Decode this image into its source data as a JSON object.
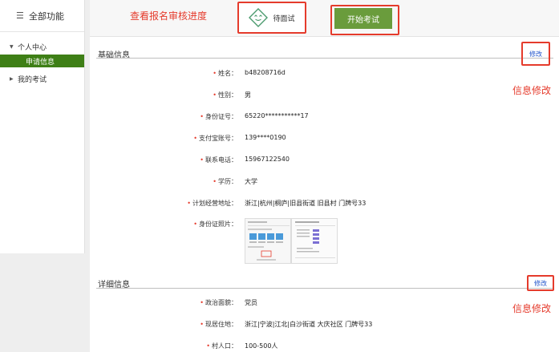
{
  "sidebar": {
    "header": "全部功能",
    "groups": [
      {
        "label": "个人中心",
        "children": [
          {
            "label": "申请信息",
            "active": true
          }
        ]
      },
      {
        "label": "我的考试",
        "children": []
      }
    ]
  },
  "annotations": {
    "status_hint": "查看报名审核进度",
    "edit_hint_1": "信息修改",
    "edit_hint_2": "信息修改",
    "color": "#e53b2c"
  },
  "status": {
    "label": "待面试",
    "icon": "smile-face-icon"
  },
  "exam_button": {
    "label": "开始考试",
    "color": "#6a9c3c"
  },
  "basic_info": {
    "title": "基础信息",
    "edit_label": "修改",
    "fields": [
      {
        "label": "姓名：",
        "value": "b48208716d",
        "required": true
      },
      {
        "label": "性别：",
        "value": "男",
        "required": true
      },
      {
        "label": "身份证号：",
        "value": "65220***********17",
        "required": true
      },
      {
        "label": "支付宝账号：",
        "value": "139****0190",
        "required": true
      },
      {
        "label": "联系电话：",
        "value": "15967122540",
        "required": true
      },
      {
        "label": "学历：",
        "value": "大学",
        "required": true
      },
      {
        "label": "计划经营地址：",
        "value": "浙江|杭州|桐庐|旧县街道 旧县村 门牌号33",
        "required": true
      },
      {
        "label": "身份证照片：",
        "value": "",
        "required": true
      }
    ]
  },
  "detail_info": {
    "title": "详细信息",
    "edit_label": "修改",
    "fields": [
      {
        "label": "政治面貌：",
        "value": "党员",
        "required": true
      },
      {
        "label": "现居住地：",
        "value": "浙江|宁波|江北|白沙街道 大庆社区 门牌号33",
        "required": true
      },
      {
        "label": "村人口：",
        "value": "100-500人",
        "required": true
      }
    ]
  }
}
